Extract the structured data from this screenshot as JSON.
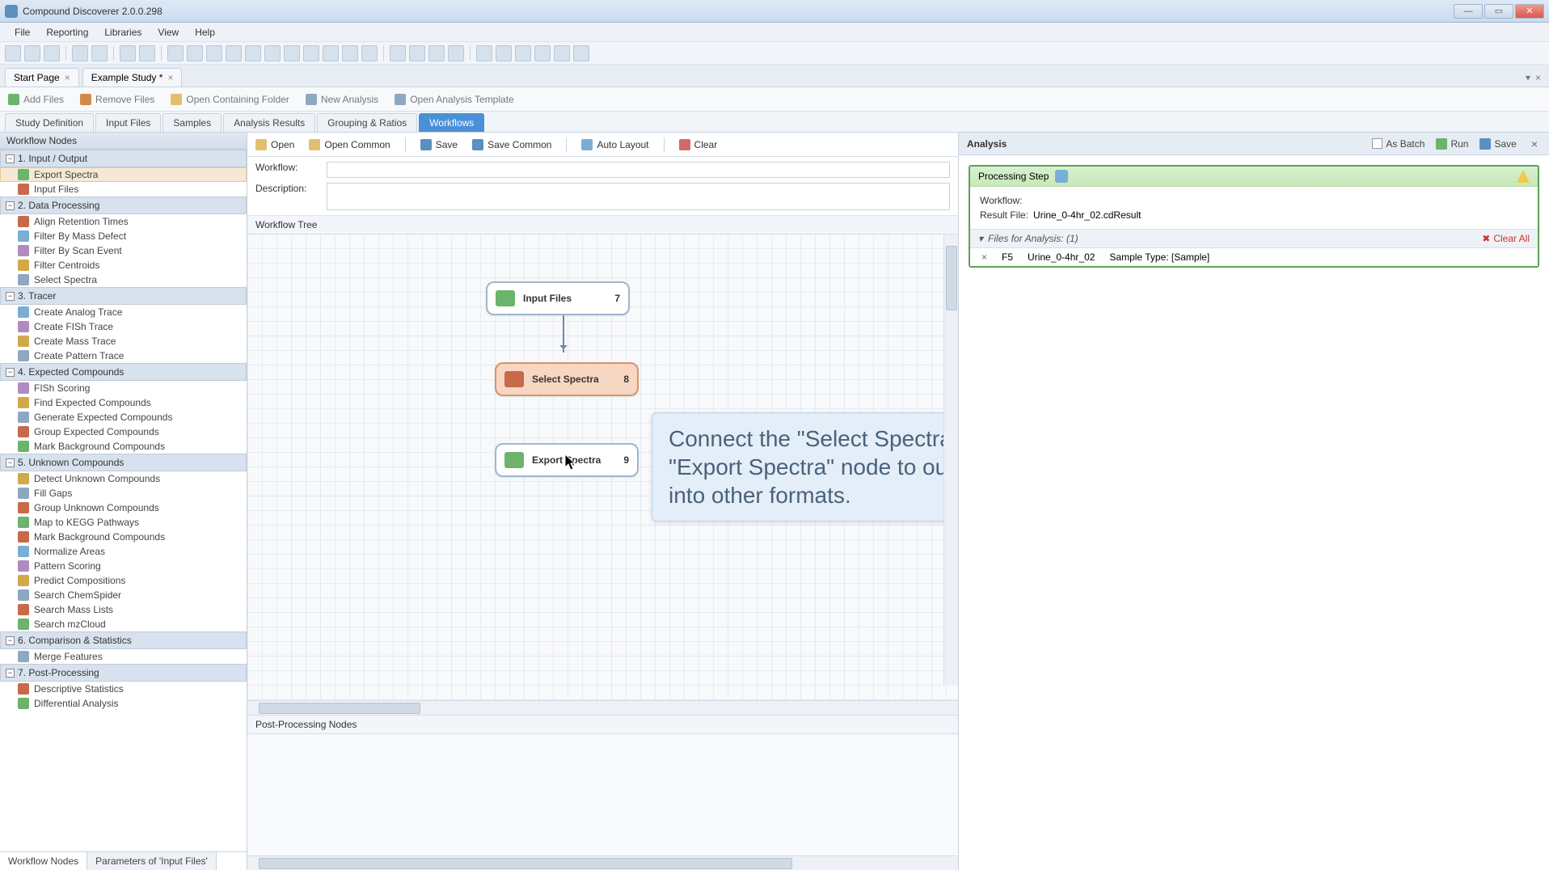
{
  "app": {
    "title": "Compound Discoverer 2.0.0.298"
  },
  "menu": [
    "File",
    "Reporting",
    "Libraries",
    "View",
    "Help"
  ],
  "doc_tabs": [
    {
      "label": "Start Page"
    },
    {
      "label": "Example Study *"
    }
  ],
  "study_actions": {
    "add_files": "Add Files",
    "remove_files": "Remove Files",
    "open_folder": "Open Containing Folder",
    "new_analysis": "New Analysis",
    "open_template": "Open Analysis Template"
  },
  "study_tabs": [
    "Study Definition",
    "Input Files",
    "Samples",
    "Analysis Results",
    "Grouping & Ratios",
    "Workflows"
  ],
  "study_tab_active": 5,
  "sidebar": {
    "header": "Workflow Nodes",
    "groups": [
      {
        "title": "1. Input / Output",
        "items": [
          "Export Spectra",
          "Input Files"
        ],
        "selected": 0
      },
      {
        "title": "2. Data Processing",
        "items": [
          "Align Retention Times",
          "Filter By Mass Defect",
          "Filter By Scan Event",
          "Filter Centroids",
          "Select Spectra"
        ]
      },
      {
        "title": "3. Tracer",
        "items": [
          "Create Analog Trace",
          "Create FISh Trace",
          "Create Mass Trace",
          "Create Pattern Trace"
        ]
      },
      {
        "title": "4. Expected Compounds",
        "items": [
          "FISh Scoring",
          "Find Expected Compounds",
          "Generate Expected Compounds",
          "Group Expected Compounds",
          "Mark Background Compounds"
        ]
      },
      {
        "title": "5. Unknown Compounds",
        "items": [
          "Detect Unknown Compounds",
          "Fill Gaps",
          "Group Unknown Compounds",
          "Map to KEGG Pathways",
          "Mark Background Compounds",
          "Normalize Areas",
          "Pattern Scoring",
          "Predict Compositions",
          "Search ChemSpider",
          "Search Mass Lists",
          "Search mzCloud"
        ]
      },
      {
        "title": "6. Comparison & Statistics",
        "items": [
          "Merge Features"
        ]
      },
      {
        "title": "7. Post-Processing",
        "items": [
          "Descriptive Statistics",
          "Differential Analysis"
        ]
      }
    ],
    "bottom_tabs": [
      "Workflow Nodes",
      "Parameters of 'Input Files'"
    ],
    "bottom_tab_active": 0
  },
  "wf_toolbar": {
    "open": "Open",
    "open_common": "Open Common",
    "save": "Save",
    "save_common": "Save Common",
    "auto_layout": "Auto Layout",
    "clear": "Clear"
  },
  "wf_meta": {
    "workflow_label": "Workflow:",
    "workflow_value": "",
    "desc_label": "Description:",
    "desc_value": ""
  },
  "wf_tree_header": "Workflow Tree",
  "nodes": {
    "input": {
      "label": "Input Files",
      "num": "7"
    },
    "select": {
      "label": "Select Spectra",
      "num": "8"
    },
    "export": {
      "label": "Export Spectra",
      "num": "9"
    }
  },
  "tooltip": "Connect the \"Select Spectra\" node to \"Export Spectra\" node to output spectra into other formats.",
  "post_header": "Post-Processing Nodes",
  "analysis": {
    "title": "Analysis",
    "as_batch": "As Batch",
    "run": "Run",
    "save": "Save",
    "step_label": "Processing Step",
    "workflow_label": "Workflow:",
    "workflow_value": "",
    "result_label": "Result File:",
    "result_value": "Urine_0-4hr_02.cdResult",
    "files_header": "Files for Analysis: (1)",
    "clear_all": "Clear All",
    "file": {
      "code": "F5",
      "name": "Urine_0-4hr_02",
      "sample": "Sample Type: [Sample]"
    }
  }
}
